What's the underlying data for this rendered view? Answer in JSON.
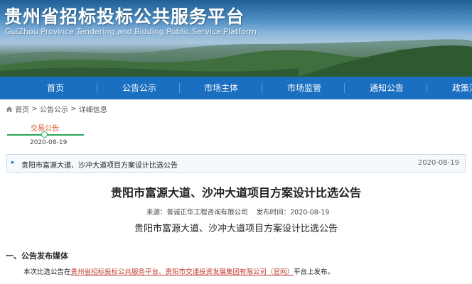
{
  "header": {
    "title": "贵州省招标投标公共服务平台",
    "subtitle": "GuiZhou Province Tendering and Bidding Public Service Platform"
  },
  "nav": {
    "items": [
      "首页",
      "公告公示",
      "市场主体",
      "市场监管",
      "通知公告",
      "政策法"
    ]
  },
  "breadcrumb": {
    "home": "首页",
    "level1": "公告公示",
    "level2": "详细信息",
    "sep": ">"
  },
  "timeline": {
    "label": "交易公告",
    "date": "2020-08-19"
  },
  "notice": {
    "title": "贵阳市富源大道、沙冲大道项目方案设计比选公告",
    "date": "2020-08-19"
  },
  "article": {
    "title": "贵阳市富源大道、沙冲大道项目方案设计比选公告",
    "source_label": "来源：",
    "source": "普诚正华工程咨询有限公司",
    "time_label": "发布时间：",
    "time": "2020-08-19",
    "subtitle": "贵阳市富源大道、沙冲大道项目方案设计比选公告",
    "section1_title": "一、公告发布媒体",
    "para1_pre": "本次比选公告在",
    "para1_link": "贵州省招标投标公共服务平台、贵阳市交通投资发展集团有限公司（官网）",
    "para1_post": "平台上发布。"
  },
  "colors": {
    "nav_bg": "#1b6fc1",
    "timeline": "#29a55a",
    "timeline_label": "#e0542e",
    "link": "#c0392b"
  }
}
